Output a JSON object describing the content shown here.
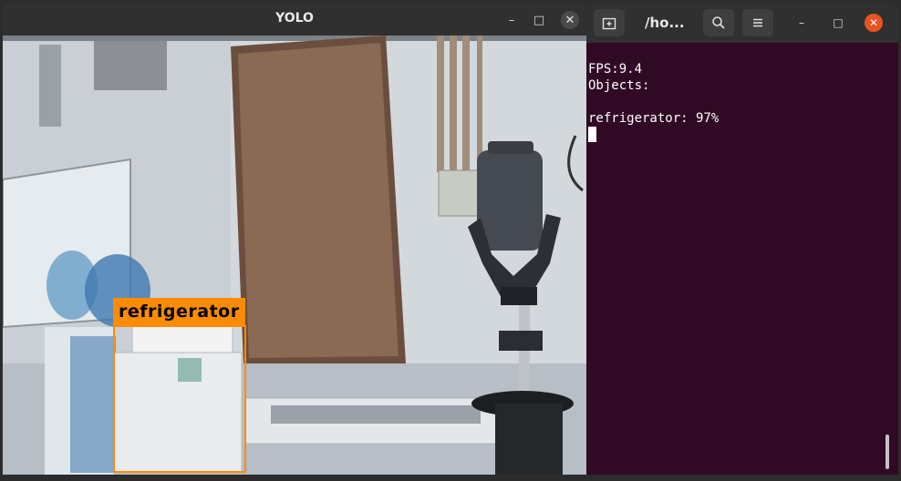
{
  "yolo_window": {
    "title": "YOLO",
    "minimize_glyph": "–",
    "maximize_glyph": "□",
    "close_glyph": "✕",
    "detection": {
      "label": "refrigerator",
      "color": "#ff8c00"
    }
  },
  "terminal": {
    "title": "/ho...",
    "new_tab_icon": "new-tab-icon",
    "search_icon": "search-icon",
    "menu_icon": "hamburger-menu-icon",
    "minimize_glyph": "–",
    "maximize_glyph": "□",
    "close_glyph": "✕",
    "lines": {
      "fps": "FPS:9.4",
      "objects": "Objects:",
      "blank": "",
      "detection": "refrigerator: 97%"
    },
    "background_color": "#300a24",
    "close_color": "#e95420"
  }
}
